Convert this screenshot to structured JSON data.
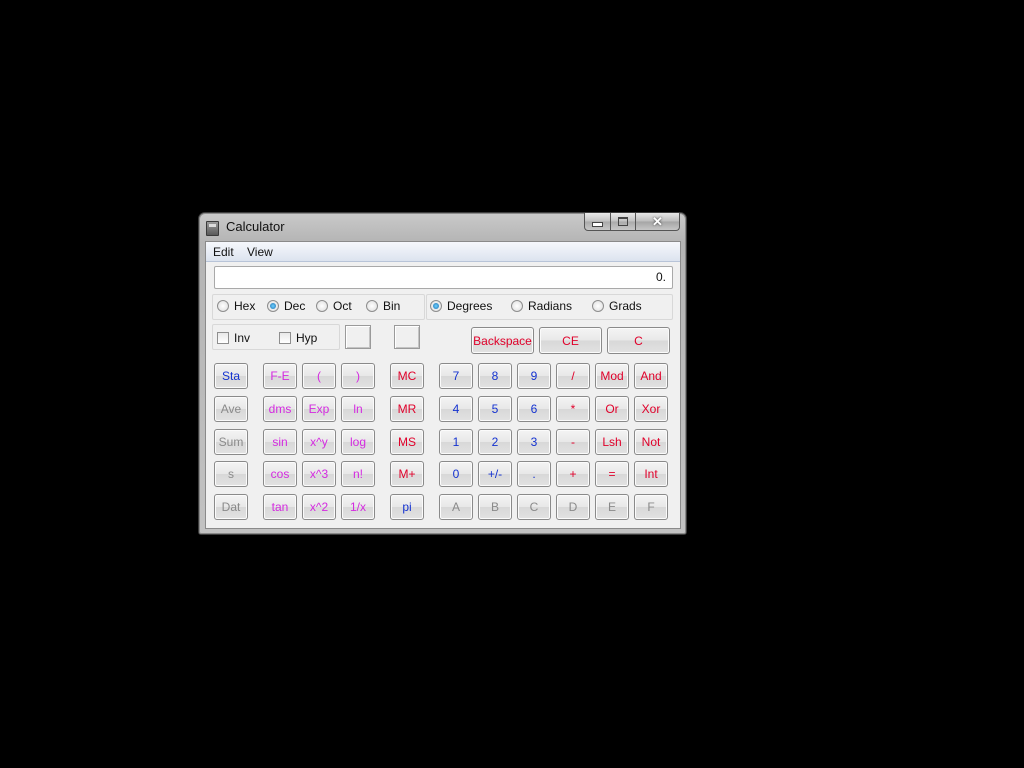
{
  "window": {
    "title": "Calculator"
  },
  "menu": [
    "Edit",
    "View"
  ],
  "display": {
    "value": "0."
  },
  "number_system": [
    {
      "label": "Hex",
      "selected": false
    },
    {
      "label": "Dec",
      "selected": true
    },
    {
      "label": "Oct",
      "selected": false
    },
    {
      "label": "Bin",
      "selected": false
    }
  ],
  "angle_units": [
    {
      "label": "Degrees",
      "selected": true
    },
    {
      "label": "Radians",
      "selected": false
    },
    {
      "label": "Grads",
      "selected": false
    }
  ],
  "checkboxes": [
    {
      "label": "Inv",
      "checked": false
    },
    {
      "label": "Hyp",
      "checked": false
    }
  ],
  "top_buttons": [
    "Backspace",
    "CE",
    "C"
  ],
  "stat_buttons": [
    "Sta",
    "Ave",
    "Sum",
    "s",
    "Dat"
  ],
  "sci_col1": [
    "F-E",
    "dms",
    "sin",
    "cos",
    "tan"
  ],
  "sci_col2": [
    "(",
    "Exp",
    "x^y",
    "x^3",
    "x^2"
  ],
  "sci_col3": [
    ")",
    "ln",
    "log",
    "n!",
    "1/x"
  ],
  "memory_buttons": [
    "MC",
    "MR",
    "MS",
    "M+",
    "pi"
  ],
  "digit_col1": [
    "7",
    "4",
    "1",
    "0",
    "A"
  ],
  "digit_col2": [
    "8",
    "5",
    "2",
    "+/-",
    "B"
  ],
  "digit_col3": [
    "9",
    "6",
    "3",
    ".",
    "C"
  ],
  "op_col1": [
    "/",
    "*",
    "-",
    "+",
    "D"
  ],
  "op_col2": [
    "Mod",
    "Or",
    "Lsh",
    "=",
    "E"
  ],
  "op_col3": [
    "And",
    "Xor",
    "Not",
    "Int",
    "F"
  ],
  "colors": {
    "red": "#e0002a",
    "blue": "#1432d0",
    "magenta": "#d42ae0",
    "disabled": "#8a8a8a"
  }
}
